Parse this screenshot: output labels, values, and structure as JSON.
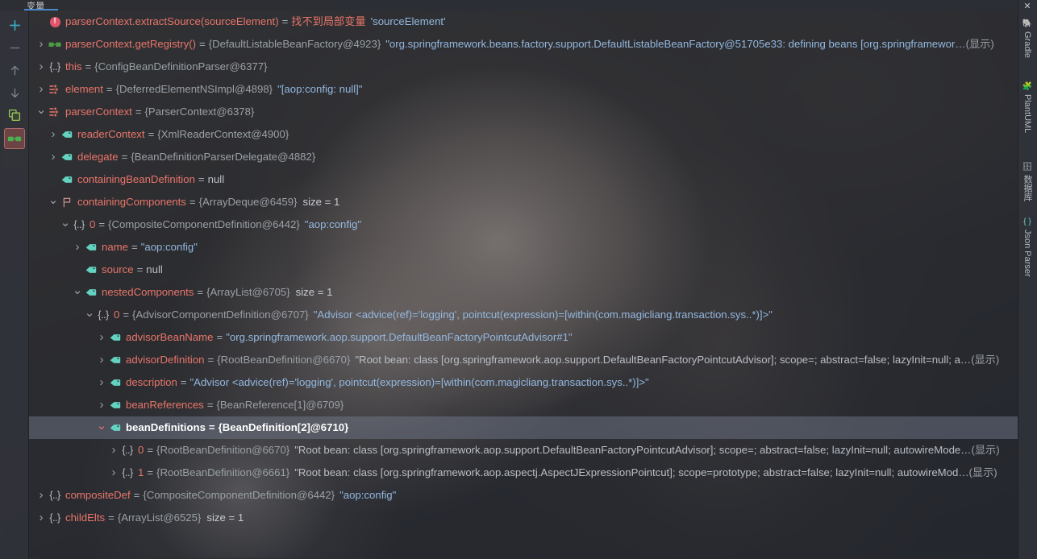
{
  "window": {
    "tab_label": "变量",
    "close_label": "✕"
  },
  "toolbar": {
    "items": [
      {
        "name": "add-watch",
        "glyph": "+",
        "tooltip": "Add"
      },
      {
        "name": "remove-watch",
        "glyph": "−",
        "tooltip": "Remove"
      },
      {
        "name": "move-up",
        "glyph": "↑",
        "tooltip": "Up"
      },
      {
        "name": "move-down",
        "glyph": "↓",
        "tooltip": "Down"
      },
      {
        "name": "copy",
        "glyph": "⧉",
        "tooltip": "Copy"
      },
      {
        "name": "watches",
        "glyph": "◉◉",
        "tooltip": "Watches"
      }
    ]
  },
  "right_tool_windows": [
    {
      "label": "Gradle",
      "icon": "elephant-icon"
    },
    {
      "label": "PlantUML",
      "icon": "plantuml-icon"
    },
    {
      "label": "数据库",
      "icon": "database-icon"
    },
    {
      "label": "Json Parser",
      "icon": "braces-icon"
    }
  ],
  "tree": {
    "rows": [
      {
        "id": "row-extract-source",
        "depth": 0,
        "chevron": "none",
        "icon": "error-icon",
        "name": "parserContext.extractSource(sourceElement)",
        "eq": "=",
        "value_error": "找不到局部变量",
        "value_string": "'sourceElement'",
        "selected": false
      },
      {
        "id": "row-get-registry",
        "depth": 0,
        "chevron": "collapsed",
        "icon": "watch-icon",
        "name": "parserContext.getRegistry()",
        "eq": "=",
        "ref": "{DefaultListableBeanFactory@4923}",
        "value_string": "\"org.springframework.beans.factory.support.DefaultListableBeanFactory@51705e33: defining beans [org.springframewor…",
        "more": "(显示)",
        "selected": false
      },
      {
        "id": "row-this",
        "depth": 0,
        "chevron": "collapsed",
        "icon": "object-icon",
        "name": "this",
        "eq": "=",
        "ref": "{ConfigBeanDefinitionParser@6377}",
        "selected": false
      },
      {
        "id": "row-element",
        "depth": 0,
        "chevron": "collapsed",
        "icon": "node-icon",
        "name": "element",
        "eq": "=",
        "ref": "{DeferredElementNSImpl@4898}",
        "value_string": "\"[aop:config: null]\"",
        "selected": false
      },
      {
        "id": "row-parser-context",
        "depth": 0,
        "chevron": "expanded",
        "icon": "node-icon",
        "name": "parserContext",
        "eq": "=",
        "ref": "{ParserContext@6378}",
        "selected": false
      },
      {
        "id": "row-reader-context",
        "depth": 1,
        "chevron": "collapsed",
        "icon": "field-icon",
        "name": "readerContext",
        "eq": "=",
        "ref": "{XmlReaderContext@4900}",
        "selected": false
      },
      {
        "id": "row-delegate",
        "depth": 1,
        "chevron": "collapsed",
        "icon": "field-icon",
        "name": "delegate",
        "eq": "=",
        "ref": "{BeanDefinitionParserDelegate@4882}",
        "selected": false
      },
      {
        "id": "row-containing-bean-definition",
        "depth": 1,
        "chevron": "none",
        "icon": "field-icon",
        "name": "containingBeanDefinition",
        "eq": "=",
        "plain": "null",
        "selected": false
      },
      {
        "id": "row-containing-components",
        "depth": 1,
        "chevron": "expanded",
        "icon": "flag-icon",
        "name": "containingComponents",
        "eq": "=",
        "ref": "{ArrayDeque@6459}",
        "size": "size = 1",
        "selected": false
      },
      {
        "id": "row-cc-0",
        "depth": 2,
        "chevron": "expanded",
        "icon": "object-icon",
        "name": "0",
        "eq": "=",
        "ref": "{CompositeComponentDefinition@6442}",
        "value_string": "\"aop:config\"",
        "selected": false
      },
      {
        "id": "row-name",
        "depth": 3,
        "chevron": "collapsed",
        "icon": "field-icon",
        "name": "name",
        "eq": "=",
        "value_string": "\"aop:config\"",
        "selected": false
      },
      {
        "id": "row-source",
        "depth": 3,
        "chevron": "none",
        "icon": "field-icon",
        "name": "source",
        "eq": "=",
        "plain": "null",
        "selected": false
      },
      {
        "id": "row-nested-components",
        "depth": 3,
        "chevron": "expanded",
        "icon": "field-icon",
        "name": "nestedComponents",
        "eq": "=",
        "ref": "{ArrayList@6705}",
        "size": "size = 1",
        "selected": false
      },
      {
        "id": "row-nc-0",
        "depth": 4,
        "chevron": "expanded",
        "icon": "object-icon",
        "name": "0",
        "eq": "=",
        "ref": "{AdvisorComponentDefinition@6707}",
        "value_string": "\"Advisor <advice(ref)='logging', pointcut(expression)=[within(com.magicliang.transaction.sys..*)]>\"",
        "selected": false
      },
      {
        "id": "row-advisor-bean-name",
        "depth": 5,
        "chevron": "collapsed",
        "icon": "field-icon",
        "name": "advisorBeanName",
        "eq": "=",
        "value_string": "\"org.springframework.aop.support.DefaultBeanFactoryPointcutAdvisor#1\"",
        "selected": false
      },
      {
        "id": "row-advisor-definition",
        "depth": 5,
        "chevron": "collapsed",
        "icon": "field-icon",
        "name": "advisorDefinition",
        "eq": "=",
        "ref": "{RootBeanDefinition@6670}",
        "value_plain": "\"Root bean: class [org.springframework.aop.support.DefaultBeanFactoryPointcutAdvisor]; scope=; abstract=false; lazyInit=null; a…",
        "more": "(显示)",
        "selected": false
      },
      {
        "id": "row-description",
        "depth": 5,
        "chevron": "collapsed",
        "icon": "field-icon",
        "name": "description",
        "eq": "=",
        "value_string": "\"Advisor <advice(ref)='logging', pointcut(expression)=[within(com.magicliang.transaction.sys..*)]>\"",
        "selected": false
      },
      {
        "id": "row-bean-references",
        "depth": 5,
        "chevron": "collapsed",
        "icon": "field-icon",
        "name": "beanReferences",
        "eq": "=",
        "ref": "{BeanReference[1]@6709}",
        "selected": false
      },
      {
        "id": "row-bean-definitions",
        "depth": 5,
        "chevron": "expanded",
        "icon": "field-icon",
        "name": "beanDefinitions",
        "eq": "=",
        "ref": "{BeanDefinition[2]@6710}",
        "selected": true
      },
      {
        "id": "row-bd-0",
        "depth": 6,
        "chevron": "collapsed",
        "icon": "object-icon",
        "name": "0",
        "eq": "=",
        "ref": "{RootBeanDefinition@6670}",
        "value_plain": "\"Root bean: class [org.springframework.aop.support.DefaultBeanFactoryPointcutAdvisor]; scope=; abstract=false; lazyInit=null; autowireMode…",
        "more": "(显示)",
        "selected": false
      },
      {
        "id": "row-bd-1",
        "depth": 6,
        "chevron": "collapsed",
        "icon": "object-icon",
        "name": "1",
        "eq": "=",
        "ref": "{RootBeanDefinition@6661}",
        "value_plain": "\"Root bean: class [org.springframework.aop.aspectj.AspectJExpressionPointcut]; scope=prototype; abstract=false; lazyInit=null; autowireMod…",
        "more": "(显示)",
        "selected": false
      },
      {
        "id": "row-composite-def",
        "depth": 0,
        "chevron": "collapsed",
        "icon": "object-icon",
        "name": "compositeDef",
        "eq": "=",
        "ref": "{CompositeComponentDefinition@6442}",
        "value_string": "\"aop:config\"",
        "selected": false
      },
      {
        "id": "row-child-elts",
        "depth": 0,
        "chevron": "collapsed",
        "icon": "object-icon",
        "name": "childElts",
        "eq": "=",
        "ref": "{ArrayList@6525}",
        "size": "size = 1",
        "selected": false
      }
    ]
  },
  "colors": {
    "name": "#e8756a",
    "reference": "#9aa0a6",
    "string": "#93b8e0",
    "plain": "#b9bec5",
    "selection": "#7b8698",
    "error": "#e0556a",
    "watch_green": "#6aab5a",
    "field_teal": "#5fd4c4",
    "accent_blue": "#4a88c7"
  }
}
